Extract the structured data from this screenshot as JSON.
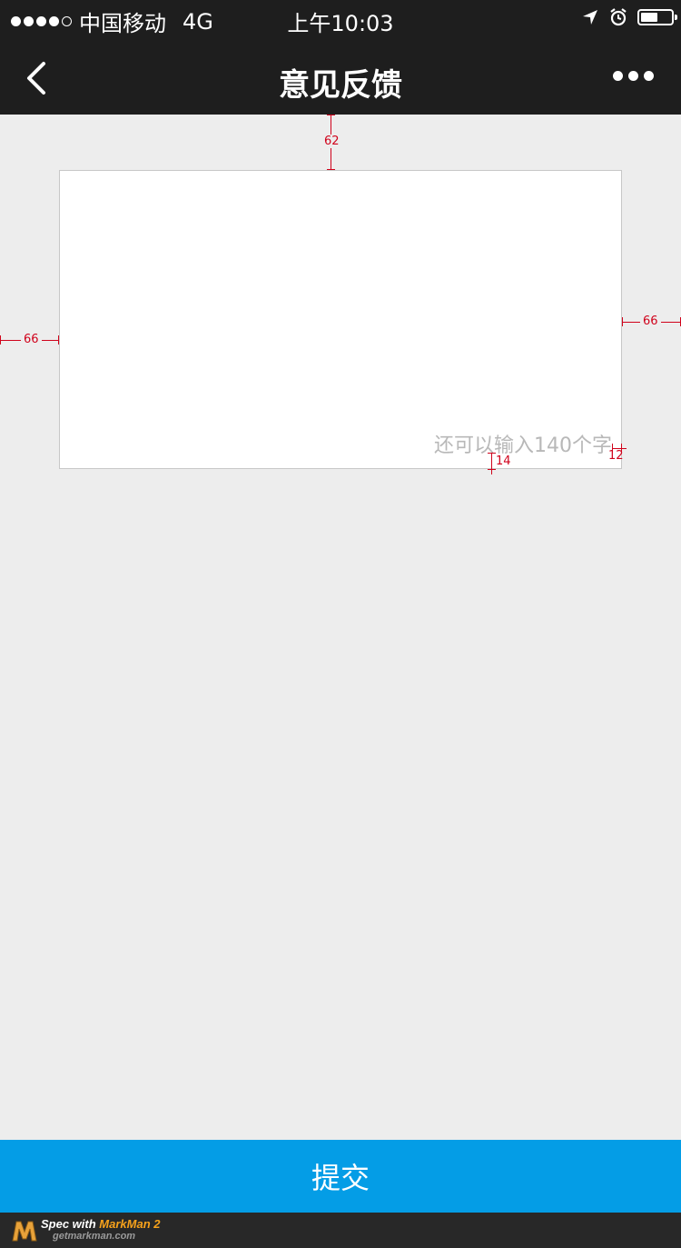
{
  "status_bar": {
    "carrier": "中国移动",
    "network": "4G",
    "time": "上午10:03",
    "signal_bars": 4,
    "signal_total": 5,
    "battery_level": 0.55
  },
  "nav": {
    "title": "意见反馈",
    "back_icon": "chevron-left-icon",
    "more_icon": "more-dots-icon"
  },
  "feedback": {
    "remaining_text": "还可以输入140个字"
  },
  "annotations": {
    "top_gap": "62",
    "left_gap": "66",
    "right_gap": "66",
    "counter_bottom": "14",
    "counter_right": "12"
  },
  "submit": {
    "label": "提交"
  },
  "markman": {
    "prefix": "Spec with ",
    "brand": "MarkMan 2",
    "site": "getmarkman.com"
  },
  "colors": {
    "bar_bg": "#1e1e1e",
    "page_bg": "#ededed",
    "accent": "#049de6",
    "annotation": "#d0021b"
  }
}
